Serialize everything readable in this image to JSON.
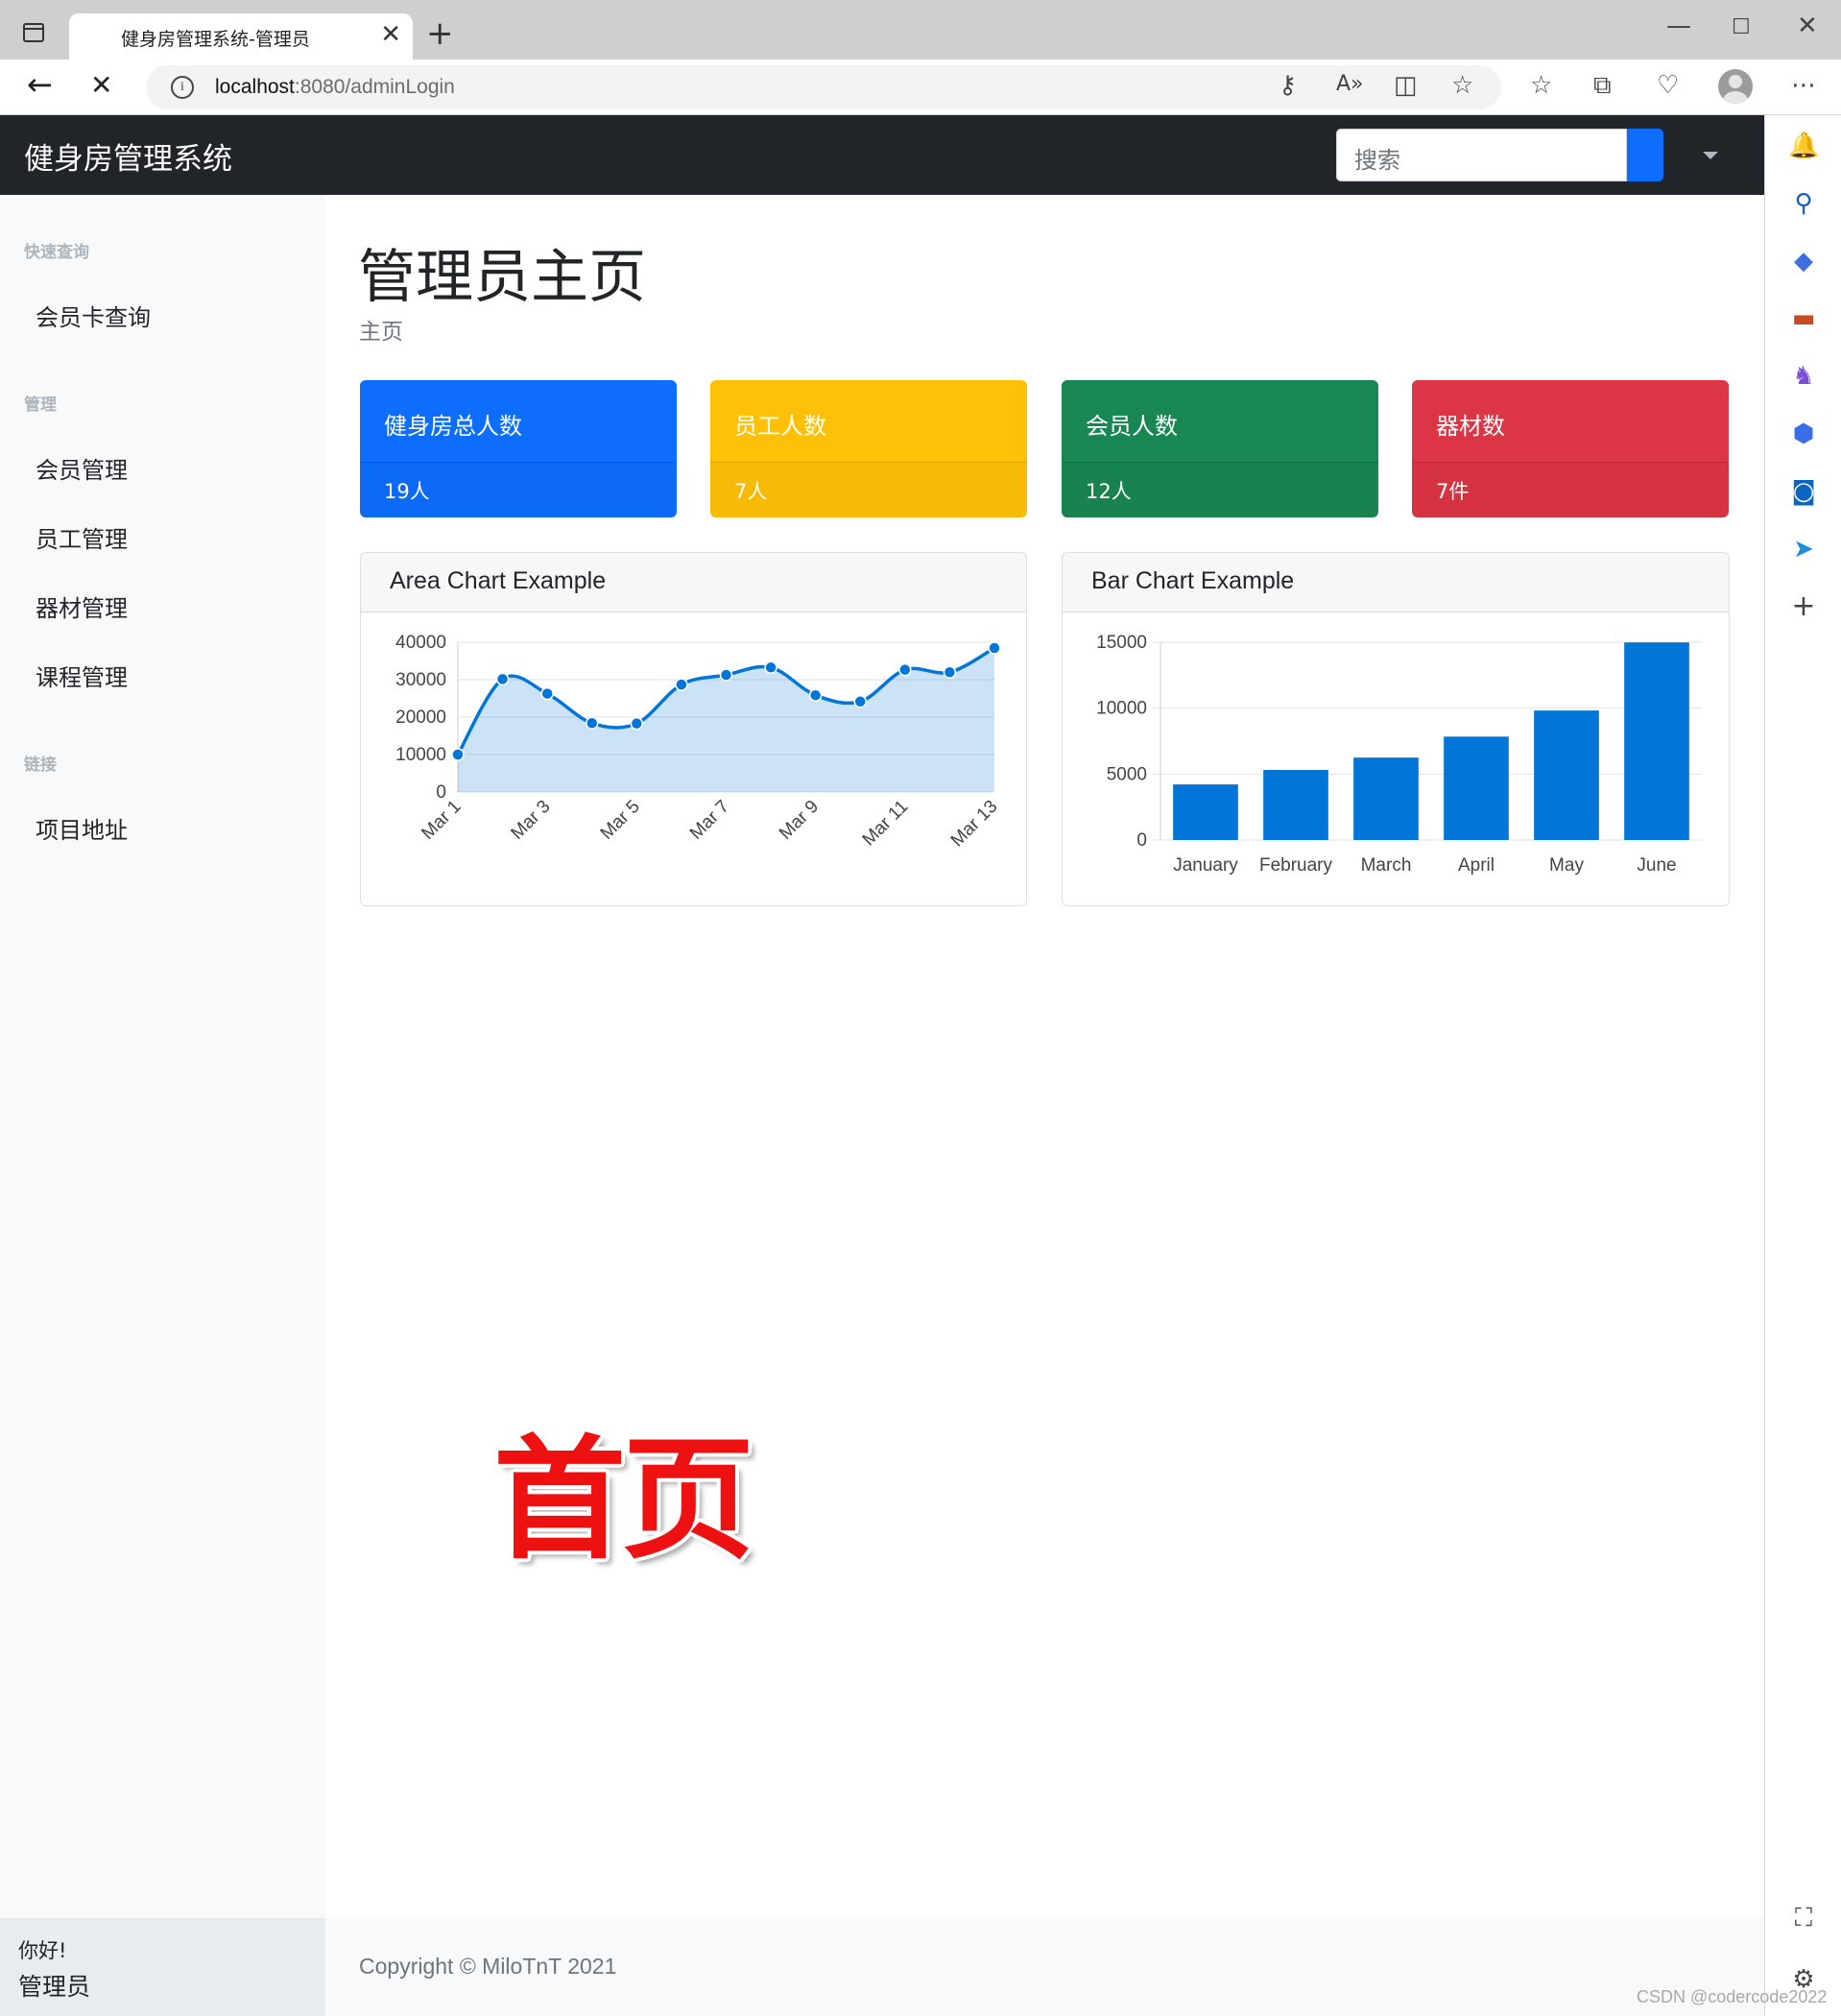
{
  "browser": {
    "tab_title": "健身房管理系统-管理员",
    "url_host": "localhost",
    "url_path": ":8080/adminLogin"
  },
  "navbar": {
    "brand": "健身房管理系统",
    "search_placeholder": "搜索"
  },
  "sidebar": {
    "sections": [
      {
        "heading": "快速查询",
        "items": [
          "会员卡查询"
        ]
      },
      {
        "heading": "管理",
        "items": [
          "会员管理",
          "员工管理",
          "器材管理",
          "课程管理"
        ]
      },
      {
        "heading": "链接",
        "items": [
          "项目地址"
        ]
      }
    ],
    "footer_greeting": "你好!",
    "footer_user": "管理员"
  },
  "main": {
    "title": "管理员主页",
    "breadcrumb": "主页",
    "stats": [
      {
        "label": "健身房总人数",
        "value": "19人",
        "color": "#0d6efd"
      },
      {
        "label": "员工人数",
        "value": "7人",
        "color": "#ffc107"
      },
      {
        "label": "会员人数",
        "value": "12人",
        "color": "#198754"
      },
      {
        "label": "器材数",
        "value": "7件",
        "color": "#dc3545"
      }
    ]
  },
  "chart_data": [
    {
      "type": "area",
      "title": "Area Chart Example",
      "x": [
        "Mar 1",
        "Mar 2",
        "Mar 3",
        "Mar 4",
        "Mar 5",
        "Mar 6",
        "Mar 7",
        "Mar 8",
        "Mar 9",
        "Mar 10",
        "Mar 11",
        "Mar 12",
        "Mar 13"
      ],
      "x_tick_labels": [
        "Mar 1",
        "Mar 3",
        "Mar 5",
        "Mar 7",
        "Mar 9",
        "Mar 11",
        "Mar 13"
      ],
      "values": [
        10000,
        30162,
        26263,
        18394,
        18287,
        28682,
        31274,
        33259,
        25849,
        24159,
        32651,
        31984,
        38451
      ],
      "ylim": [
        0,
        40000
      ],
      "y_ticks": [
        0,
        10000,
        20000,
        30000,
        40000
      ],
      "grid": true,
      "color": "#0275d8"
    },
    {
      "type": "bar",
      "title": "Bar Chart Example",
      "categories": [
        "January",
        "February",
        "March",
        "April",
        "May",
        "June"
      ],
      "values": [
        4215,
        5312,
        6251,
        7841,
        9821,
        14984
      ],
      "ylim": [
        0,
        15000
      ],
      "y_ticks": [
        0,
        5000,
        10000,
        15000
      ],
      "grid": true,
      "color": "#0275d8"
    }
  ],
  "footer": {
    "copyright": "Copyright © MiloTnT 2021"
  },
  "overlay_label": "首页",
  "watermark": "CSDN @codercode2022"
}
